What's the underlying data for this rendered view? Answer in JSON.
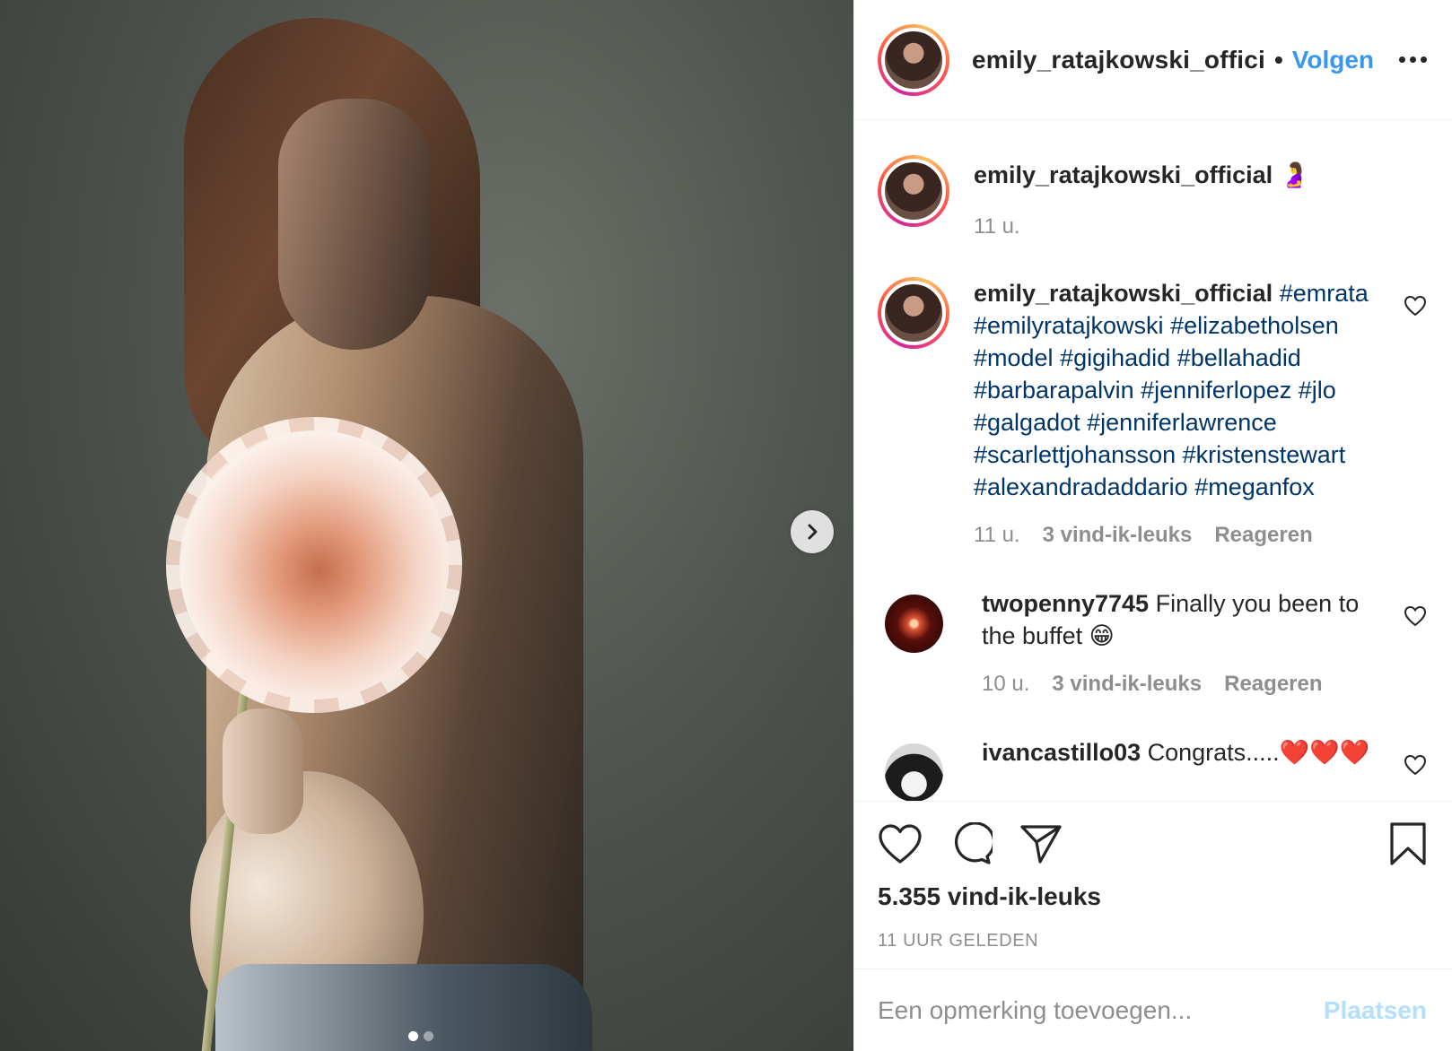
{
  "post": {
    "author": {
      "username_header": "emily_ratajkowski_offici",
      "separator": "•",
      "follow_label": "Volgen"
    },
    "caption_post": {
      "username": "emily_ratajkowski_official",
      "emoji": "🤰",
      "time": "11 u."
    },
    "comments": [
      {
        "username": "emily_ratajkowski_official",
        "text_parts": [
          "#emrata",
          "#emilyratajkowski",
          "#elizabetholsen",
          "#model",
          "#gigihadid",
          "#bellahadid",
          "#barbarapalvin",
          "#jenniferlopez",
          "#jlo",
          "#galgadot",
          "#jenniferlawrence",
          "#scarlettjohansson",
          "#kristenstewart",
          "#alexandradaddario",
          "#meganfox"
        ],
        "time": "11 u.",
        "likes": "3 vind-ik-leuks",
        "reply": "Reageren"
      },
      {
        "username": "twopenny7745",
        "text": "Finally you been to the buffet 😁",
        "time": "10 u.",
        "likes": "3 vind-ik-leuks",
        "reply": "Reageren"
      },
      {
        "username": "ivancastillo03",
        "text": "Congrats.....❤️❤️❤️"
      }
    ],
    "likes_total": "5.355 vind-ik-leuks",
    "posted_ago": "11 UUR GELEDEN",
    "comment_input": {
      "placeholder": "Een opmerking toevoegen...",
      "post_label": "Plaatsen"
    },
    "carousel": {
      "total": 2,
      "current": 1
    }
  },
  "colors": {
    "accent_blue": "#3897f0",
    "hashtag": "#003569",
    "muted": "#8e8e8e",
    "post_disabled": "#b2dffc"
  },
  "icons": [
    "chevron-right-icon",
    "more-icon",
    "heart-icon",
    "comment-icon",
    "share-icon",
    "bookmark-icon"
  ]
}
